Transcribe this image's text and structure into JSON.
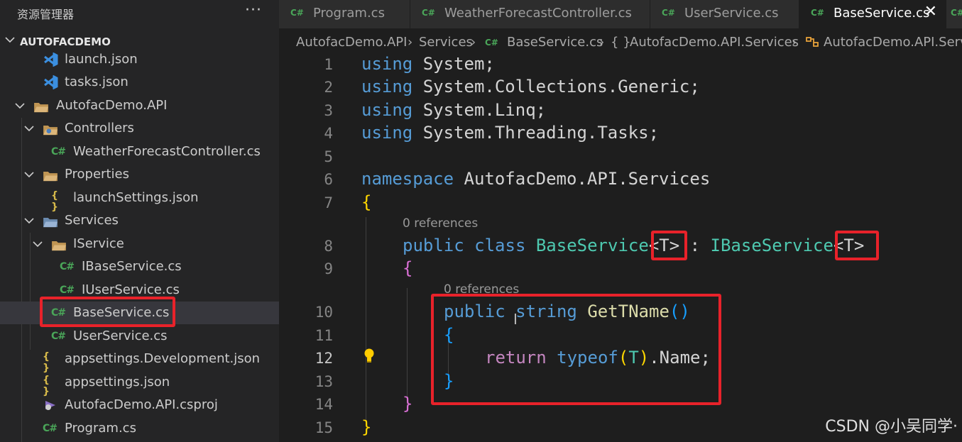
{
  "sidebar": {
    "title": "资源管理器",
    "more": "···",
    "project": "AUTOFACDEMO",
    "items": [
      {
        "label": "launch.json",
        "type": "vscode"
      },
      {
        "label": "tasks.json",
        "type": "vscode"
      },
      {
        "label": "AutofacDemo.API",
        "type": "folder"
      },
      {
        "label": "Controllers",
        "type": "folder"
      },
      {
        "label": "WeatherForecastController.cs",
        "type": "cs"
      },
      {
        "label": "Properties",
        "type": "folder"
      },
      {
        "label": "launchSettings.json",
        "type": "json"
      },
      {
        "label": "Services",
        "type": "folder"
      },
      {
        "label": "IService",
        "type": "folder"
      },
      {
        "label": "IBaseService.cs",
        "type": "cs"
      },
      {
        "label": "IUserService.cs",
        "type": "cs"
      },
      {
        "label": "BaseService.cs",
        "type": "cs"
      },
      {
        "label": "UserService.cs",
        "type": "cs"
      },
      {
        "label": "appsettings.Development.json",
        "type": "json"
      },
      {
        "label": "appsettings.json",
        "type": "json"
      },
      {
        "label": "AutofacDemo.API.csproj",
        "type": "csproj"
      },
      {
        "label": "Program.cs",
        "type": "cs"
      }
    ],
    "cs_icon": "C#",
    "json_icon": "{ }"
  },
  "tabs": [
    {
      "label": "Program.cs"
    },
    {
      "label": "WeatherForecastController.cs"
    },
    {
      "label": "UserService.cs"
    },
    {
      "label": "BaseService.cs",
      "active": true
    }
  ],
  "tab_close": "✕",
  "breadcrumb": {
    "project": "AutofacDemo.API",
    "folder": "Services",
    "file": "BaseService.cs",
    "namespace": "AutofacDemo.API.Services",
    "class": "AutofacDemo.API.Servi"
  },
  "editor": {
    "line_numbers": [
      "1",
      "2",
      "3",
      "4",
      "5",
      "6",
      "7",
      "8",
      "9",
      "10",
      "11",
      "12",
      "13",
      "14",
      "15"
    ],
    "current_line": "12",
    "codelens": [
      "0 references",
      "0 references"
    ],
    "code": {
      "l1_kw": "using",
      "l1_rest": " System;",
      "l2_kw": "using",
      "l2_rest": " System.Collections.Generic;",
      "l3_kw": "using",
      "l3_rest": " System.Linq;",
      "l4_kw": "using",
      "l4_rest": " System.Threading.Tasks;",
      "l6_kw": "namespace",
      "l6_rest": " AutofacDemo.API.Services",
      "l7": "{",
      "l8_kw1": "public",
      "l8_kw2": "class",
      "l8_type": "BaseService",
      "l8_gen1": "<T>",
      "l8_colon": " : ",
      "l8_iface": "IBaseService",
      "l8_gen2": "<T>",
      "l9": "{",
      "l10_kw1": "public",
      "l10_kw2": "string",
      "l10_fn": "GetTName",
      "l10_paren": "()",
      "l11": "{",
      "l12_kw": "return",
      "l12_typeof": "typeof",
      "l12_p1": "(",
      "l12_t": "T",
      "l12_p2": ")",
      "l12_rest": ".Name;",
      "l13": "}",
      "l14": "}",
      "l15": "}"
    }
  },
  "watermark": "CSDN @小吴同学·",
  "colors": {
    "highlight_box": "#e8222a",
    "keyword": "#569cd6",
    "type": "#4ec9b0",
    "function": "#dcdcaa",
    "control_keyword": "#c586c0"
  }
}
